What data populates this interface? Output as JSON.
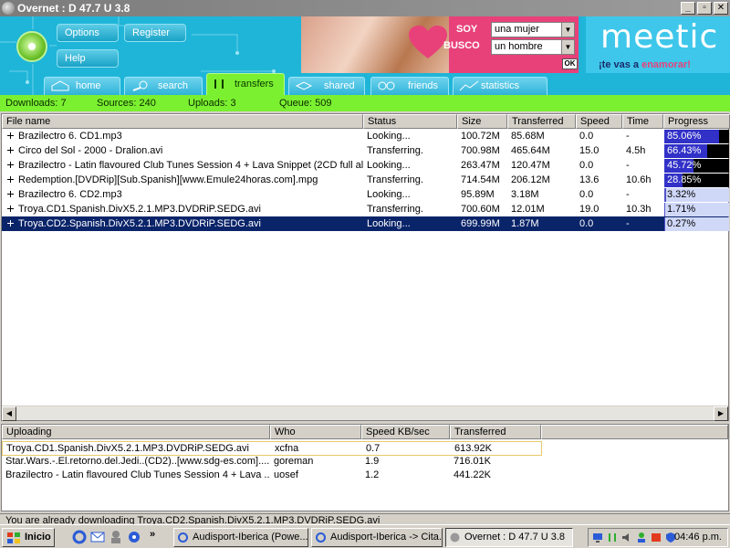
{
  "window": {
    "title": "Overnet : D 47.7 U 3.8"
  },
  "header": {
    "buttons": [
      "Options",
      "Register",
      "Help"
    ],
    "tabs": [
      "home",
      "search",
      "transfers",
      "shared",
      "friends",
      "statistics"
    ]
  },
  "ad": {
    "soy_label": "SOY",
    "busco_label": "BUSCO",
    "soy_value": "una mujer",
    "busco_value": "un hombre",
    "ok_label": "OK",
    "brand": "meetic",
    "slogan_start": "¡te vas a ",
    "slogan_end": "enamorar!"
  },
  "stats": {
    "downloads": "Downloads: 7",
    "sources": "Sources: 240",
    "uploads": "Uploads: 3",
    "queue": "Queue: 509"
  },
  "downloads": {
    "columns": [
      "File name",
      "Status",
      "Size",
      "Transferred",
      "Speed",
      "Time",
      "Progress"
    ],
    "rows": [
      {
        "name": "Brazilectro 6. CD1.mp3",
        "status": "Looking...",
        "size": "100.72M",
        "transferred": "85.68M",
        "speed": "0.0",
        "time": "-",
        "progress_label": "85.06%",
        "progress": 0.8506
      },
      {
        "name": "Circo del Sol - 2000 - Dralion.avi",
        "status": "Transferring.",
        "size": "700.98M",
        "transferred": "465.64M",
        "speed": "15.0",
        "time": "4.5h",
        "progress_label": "66.43%",
        "progress": 0.6643
      },
      {
        "name": "Brazilectro - Latin flavoured Club Tunes Session 4 + Lava Snippet (2CD full al...",
        "status": "Looking...",
        "size": "263.47M",
        "transferred": "120.47M",
        "speed": "0.0",
        "time": "-",
        "progress_label": "45.72%",
        "progress": 0.4572
      },
      {
        "name": "Redemption.[DVDRip][Sub.Spanish][www.Emule24horas.com].mpg",
        "status": "Transferring.",
        "size": "714.54M",
        "transferred": "206.12M",
        "speed": "13.6",
        "time": "10.6h",
        "progress_label": "28.85%",
        "progress": 0.2885
      },
      {
        "name": "Brazilectro 6. CD2.mp3",
        "status": "Looking...",
        "size": "95.89M",
        "transferred": "3.18M",
        "speed": "0.0",
        "time": "-",
        "progress_label": "3.32%",
        "progress": 0.0332
      },
      {
        "name": "Troya.CD1.Spanish.DivX5.2.1.MP3.DVDRiP.SEDG.avi",
        "status": "Transferring.",
        "size": "700.60M",
        "transferred": "12.01M",
        "speed": "19.0",
        "time": "10.3h",
        "progress_label": "1.71%",
        "progress": 0.0171
      },
      {
        "name": "Troya.CD2.Spanish.DivX5.2.1.MP3.DVDRiP.SEDG.avi",
        "status": "Looking...",
        "size": "699.99M",
        "transferred": "1.87M",
        "speed": "0.0",
        "time": "-",
        "progress_label": "0.27%",
        "progress": 0.0027
      }
    ]
  },
  "uploads": {
    "columns": [
      "Uploading",
      "Who",
      "Speed KB/sec",
      "Transferred"
    ],
    "rows": [
      {
        "name": "Troya.CD1.Spanish.DivX5.2.1.MP3.DVDRiP.SEDG.avi",
        "who": "xcfna",
        "speed": "0.7",
        "transferred": "613.92K"
      },
      {
        "name": "Star.Wars.-.El.retorno.del.Jedi..(CD2)..[www.sdg-es.com]......",
        "who": "goreman",
        "speed": "1.9",
        "transferred": "716.01K"
      },
      {
        "name": "Brazilectro - Latin flavoured Club Tunes Session 4 + Lava ...",
        "who": "uosef",
        "speed": "1.2",
        "transferred": "441.22K"
      }
    ]
  },
  "statusbar": {
    "text": "You are already downloading Troya.CD2.Spanish.DivX5.2.1.MP3.DVDRiP.SEDG.avi"
  },
  "taskbar": {
    "start": "Inicio",
    "tasks": [
      "Audisport-Iberica (Powe...",
      "Audisport-Iberica -> Cita...",
      "Overnet : D 47.7 U 3.8"
    ],
    "clock": "04:46 p.m."
  }
}
